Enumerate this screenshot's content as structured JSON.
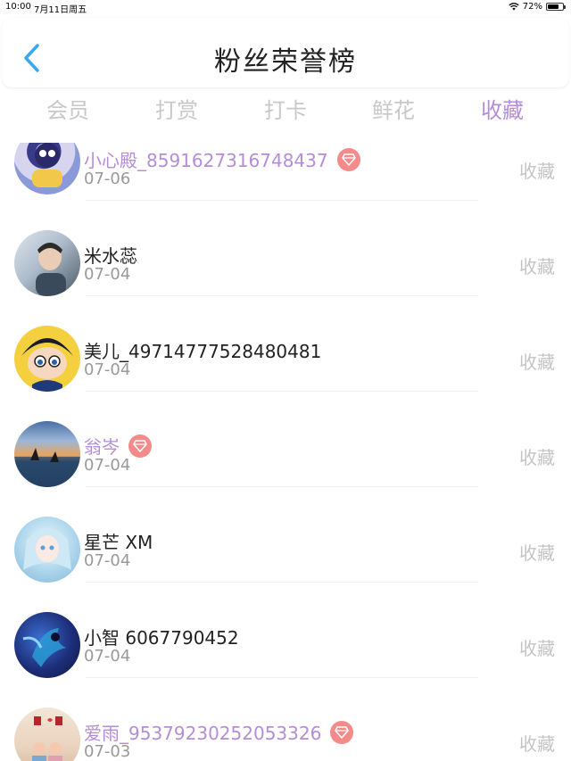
{
  "status_bar": {
    "time": "10:00",
    "date": "7月11日周五",
    "battery_text": "72%",
    "battery_level": 0.72
  },
  "header": {
    "title": "粉丝荣誉榜",
    "back_icon": "chevron-left-icon",
    "accent_color": "#3aa8f0"
  },
  "tabs": [
    {
      "label": "会员",
      "active": false
    },
    {
      "label": "打赏",
      "active": false
    },
    {
      "label": "打卡",
      "active": false
    },
    {
      "label": "鲜花",
      "active": false
    },
    {
      "label": "收藏",
      "active": true
    }
  ],
  "active_tab_color": "#b48cd8",
  "fans": [
    {
      "name": "小心殿_8591627316748437",
      "date": "07-06",
      "vip": true,
      "action": "收藏"
    },
    {
      "name": "米水蕊",
      "date": "07-04",
      "vip": false,
      "action": "收藏"
    },
    {
      "name": "美儿_49714777528480481",
      "date": "07-04",
      "vip": false,
      "action": "收藏"
    },
    {
      "name": "翁岑",
      "date": "07-04",
      "vip": true,
      "action": "收藏"
    },
    {
      "name": "星芒 XM",
      "date": "07-04",
      "vip": false,
      "action": "收藏"
    },
    {
      "name": "小智 6067790452",
      "date": "07-04",
      "vip": false,
      "action": "收藏"
    },
    {
      "name": "爱雨_95379230252053326",
      "date": "07-03",
      "vip": true,
      "action": "收藏"
    }
  ]
}
